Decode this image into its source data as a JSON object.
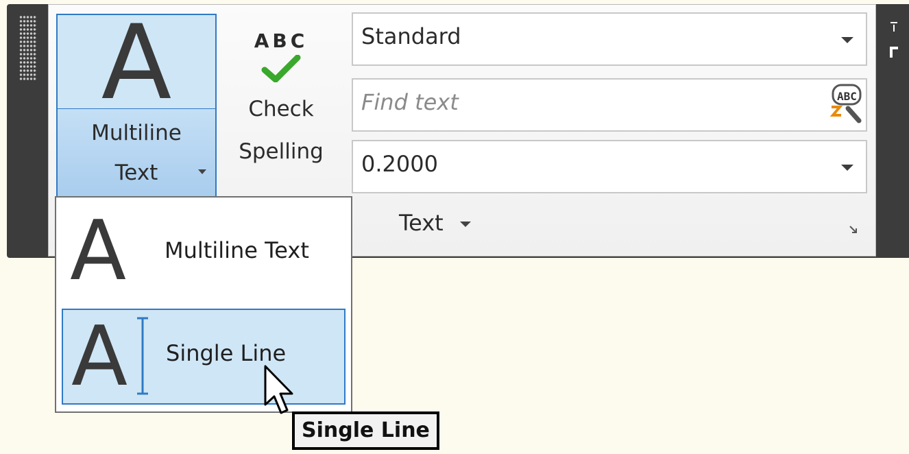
{
  "ribbon": {
    "multiline_button": {
      "glyph": "A",
      "label_line1": "Multiline",
      "label_line2": "Text"
    },
    "check_spelling": {
      "glyph": "ABC",
      "label_line1": "Check",
      "label_line2": "Spelling"
    },
    "text_style_select": {
      "value": "Standard"
    },
    "find_text": {
      "placeholder": "Find text",
      "icon": "find-replace-abc-icon"
    },
    "text_height_select": {
      "value": "0.2000"
    },
    "group_label": "Text"
  },
  "dropdown": {
    "items": [
      {
        "glyph": "A",
        "label": "Multiline Text"
      },
      {
        "glyph": "A",
        "label": "Single Line"
      }
    ]
  },
  "tooltip": "Single Line",
  "colors": {
    "accent_blue": "#2f7ac4",
    "hover_fill": "#cfe6f6",
    "panel_dark": "#3c3c3c",
    "background": "#fdfaee"
  }
}
